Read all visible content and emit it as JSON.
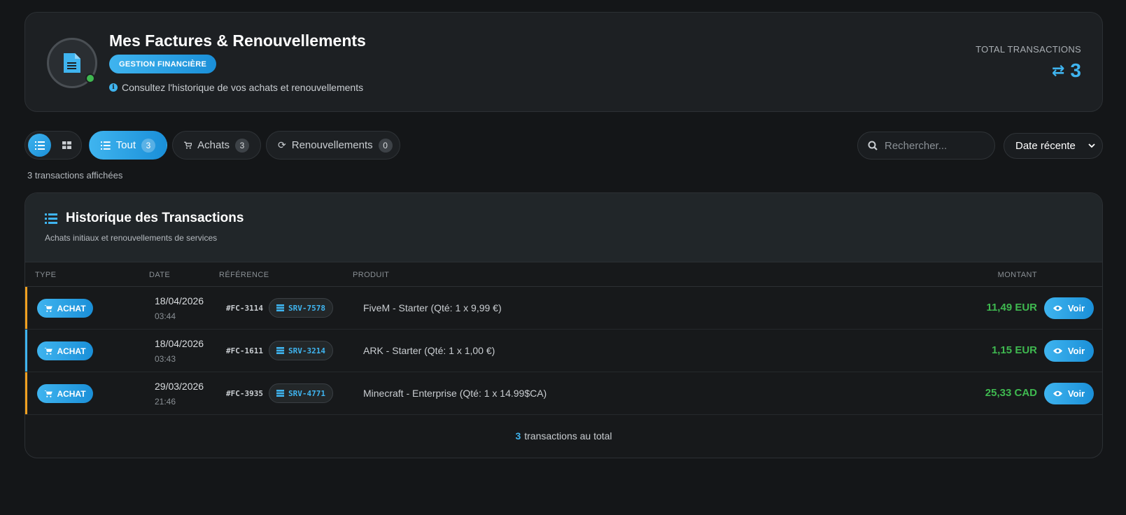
{
  "header": {
    "title": "Mes Factures & Renouvellements",
    "badge": "GESTION FINANCIÈRE",
    "subtitle": "Consultez l'historique de vos achats et renouvellements",
    "total_label": "TOTAL TRANSACTIONS",
    "total_value": "3"
  },
  "toolbar": {
    "filters": [
      {
        "label": "Tout",
        "count": "3",
        "active": true
      },
      {
        "label": "Achats",
        "count": "3",
        "active": false
      },
      {
        "label": "Renouvellements",
        "count": "0",
        "active": false
      }
    ],
    "search_placeholder": "Rechercher...",
    "sort_value": "Date récente",
    "shown_count": "3 transactions affichées"
  },
  "table": {
    "title": "Historique des Transactions",
    "subtitle": "Achats initiaux et renouvellements de services",
    "columns": {
      "type": "TYPE",
      "date": "DATE",
      "reference": "RÉFÉRENCE",
      "product": "PRODUIT",
      "amount": "MONTANT"
    },
    "rows": [
      {
        "type": "ACHAT",
        "date": "18/04/2026",
        "time": "03:44",
        "ref": "#FC-3114",
        "srv": "SRV-7578",
        "product": "FiveM - Starter (Qté: 1 x 9,99 €)",
        "amount": "11,49 EUR",
        "action": "Voir",
        "accent": "#f0a020"
      },
      {
        "type": "ACHAT",
        "date": "18/04/2026",
        "time": "03:43",
        "ref": "#FC-1611",
        "srv": "SRV-3214",
        "product": "ARK - Starter (Qté: 1 x 1,00 €)",
        "amount": "1,15 EUR",
        "action": "Voir",
        "accent": "#3fb4ef"
      },
      {
        "type": "ACHAT",
        "date": "29/03/2026",
        "time": "21:46",
        "ref": "#FC-3935",
        "srv": "SRV-4771",
        "product": "Minecraft - Enterprise (Qté: 1 x 14.99$CA)",
        "amount": "25,33 CAD",
        "action": "Voir",
        "accent": "#f0a020"
      }
    ],
    "footer_count": "3",
    "footer_text": "transactions au total"
  },
  "colors": {
    "accent": "#3fb4ef",
    "success": "#3fb950",
    "warning": "#f0a020"
  }
}
